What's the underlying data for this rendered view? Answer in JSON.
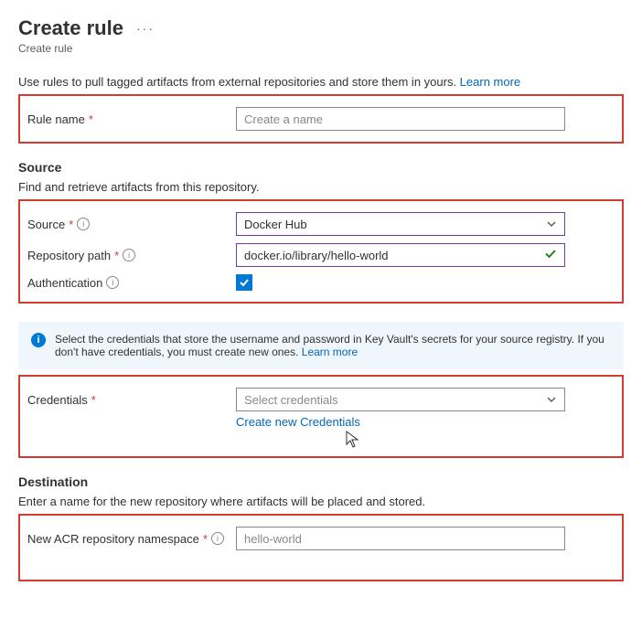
{
  "header": {
    "title": "Create rule",
    "subtitle": "Create rule"
  },
  "intro": {
    "text": "Use rules to pull tagged artifacts from external repositories and store them in yours. ",
    "learn_more": "Learn more"
  },
  "rule_name": {
    "label": "Rule name",
    "placeholder": "Create a name",
    "value": ""
  },
  "source_section": {
    "header": "Source",
    "desc": "Find and retrieve artifacts from this repository."
  },
  "source": {
    "label": "Source",
    "value": "Docker Hub"
  },
  "repository_path": {
    "label": "Repository path",
    "value": "docker.io/library/hello-world"
  },
  "authentication": {
    "label": "Authentication",
    "checked": true
  },
  "alert": {
    "text": "Select the credentials that store the username and password in Key Vault's secrets for your source registry. If you don't have credentials, you must create new ones. ",
    "learn_more": "Learn more"
  },
  "credentials": {
    "label": "Credentials",
    "placeholder": "Select credentials",
    "create_new": "Create new Credentials"
  },
  "destination_section": {
    "header": "Destination",
    "desc": "Enter a name for the new repository where artifacts will be placed and stored."
  },
  "namespace": {
    "label": "New ACR repository namespace",
    "placeholder": "hello-world",
    "value": ""
  }
}
